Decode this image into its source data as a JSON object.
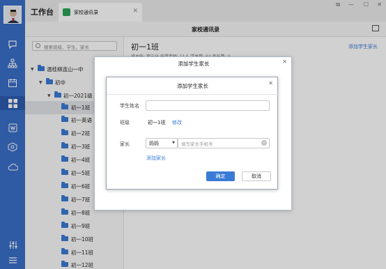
{
  "app": {
    "title": "工作台",
    "tab_label": "家校通讯录",
    "tab_close": "✕"
  },
  "header": {
    "title": "家校通讯录"
  },
  "sidebar": {
    "search_placeholder": "搜索班级、学生、家长",
    "tree": [
      {
        "label": "温桂柳连山一中",
        "caret": "▼"
      },
      {
        "label": "初中",
        "caret": "▼"
      },
      {
        "label": "初一2021级",
        "caret": "▼"
      },
      {
        "label": "初一1班",
        "selected": true
      },
      {
        "label": "初一英语"
      },
      {
        "label": "初一2班"
      },
      {
        "label": "初一3班"
      },
      {
        "label": "初一4班"
      },
      {
        "label": "初一5班"
      },
      {
        "label": "初一6班"
      },
      {
        "label": "初一7班"
      },
      {
        "label": "初一8班"
      },
      {
        "label": "初一9班"
      },
      {
        "label": "初一10班"
      },
      {
        "label": "初一11班"
      },
      {
        "label": "初一12班"
      }
    ]
  },
  "main": {
    "class_title": "初一1班",
    "class_sub": "班主任: 李三分   任课老师: 11人   学生数: 64   家长数: 0",
    "add_parent_link": "添加学生家长"
  },
  "outer_dialog": {
    "title": "添加学生家长",
    "close": "✕"
  },
  "dialog": {
    "title": "添加学生家长",
    "close": "✕",
    "student_name_label": "学生姓名",
    "student_name_value": "",
    "class_label": "班级",
    "class_value": "初一1班",
    "class_edit": "修改",
    "parent_label": "家长",
    "relation_value": "妈妈",
    "phone_placeholder": "填写家长手机号",
    "add_parent": "添加家长",
    "ok": "确定",
    "cancel": "取消"
  },
  "colors": {
    "rail": "#3a6ec9",
    "accent": "#3a7bd5"
  }
}
